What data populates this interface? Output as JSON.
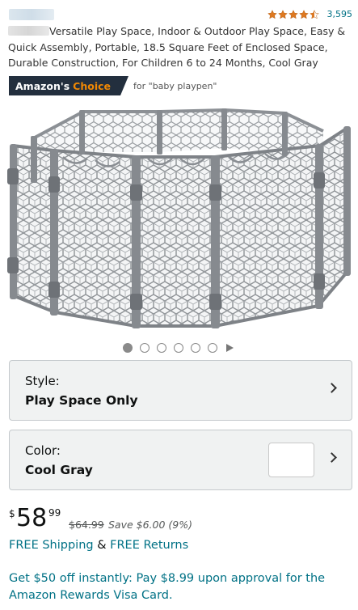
{
  "header": {
    "brand_blurred": true,
    "rating_stars": 4.5,
    "review_count": "3,595"
  },
  "product": {
    "title": "Versatile Play Space, Indoor & Outdoor Play Space, Easy & Quick Assembly, Portable, 18.5 Square Feet of Enclosed Space, Durable Construction, For Children 6 to 24 Months, Cool Gray"
  },
  "badge": {
    "prefix": "Amazon's",
    "accent": "Choice",
    "for_text": "for \"baby playpen\""
  },
  "gallery": {
    "image_count": 6,
    "active_index": 0
  },
  "style_selector": {
    "label": "Style:",
    "value": "Play Space Only"
  },
  "color_selector": {
    "label": "Color:",
    "value": "Cool Gray"
  },
  "price": {
    "currency": "$",
    "dollars": "58",
    "cents": "99",
    "list_price": "$64.99",
    "savings": "Save $6.00 (9%)"
  },
  "shipping": {
    "free_shipping": "FREE Shipping",
    "joiner": "&",
    "free_returns": "FREE Returns"
  },
  "promo": {
    "text": "Get $50 off instantly: Pay $8.99 upon approval for the Amazon Rewards Visa Card."
  },
  "colors": {
    "link": "#007185",
    "star": "#de7921",
    "badge_bg": "#232f3e",
    "badge_accent": "#f08804",
    "selector_bg": "#f0f2f2"
  }
}
